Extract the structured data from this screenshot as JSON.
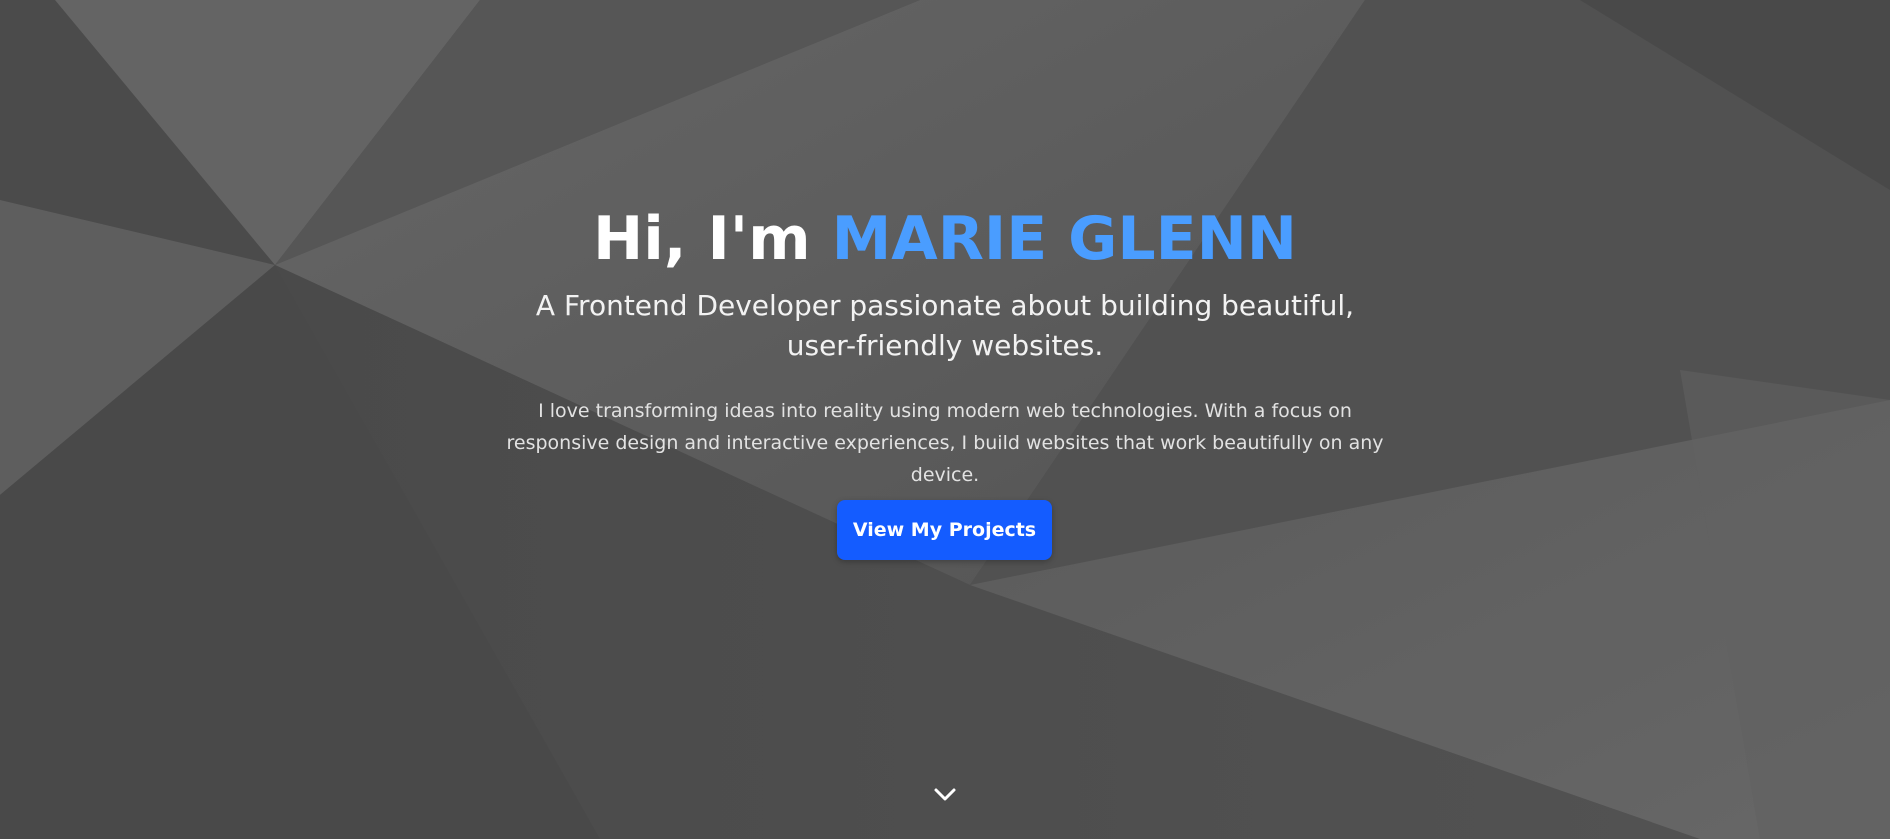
{
  "hero": {
    "greeting": "Hi, I'm ",
    "name": "MARIE GLENN",
    "subtitle": "A Frontend Developer passionate about building beautiful, user-friendly websites.",
    "description": "I love transforming ideas into reality using modern web technologies. With a focus on responsive design and interactive experiences, I build websites that work beautifully on any device.",
    "cta_label": "View My Projects",
    "scroll_icon": "chevron-down-icon"
  },
  "colors": {
    "accent": "#4a9dff",
    "button": "#145cff",
    "background": "#505050"
  }
}
